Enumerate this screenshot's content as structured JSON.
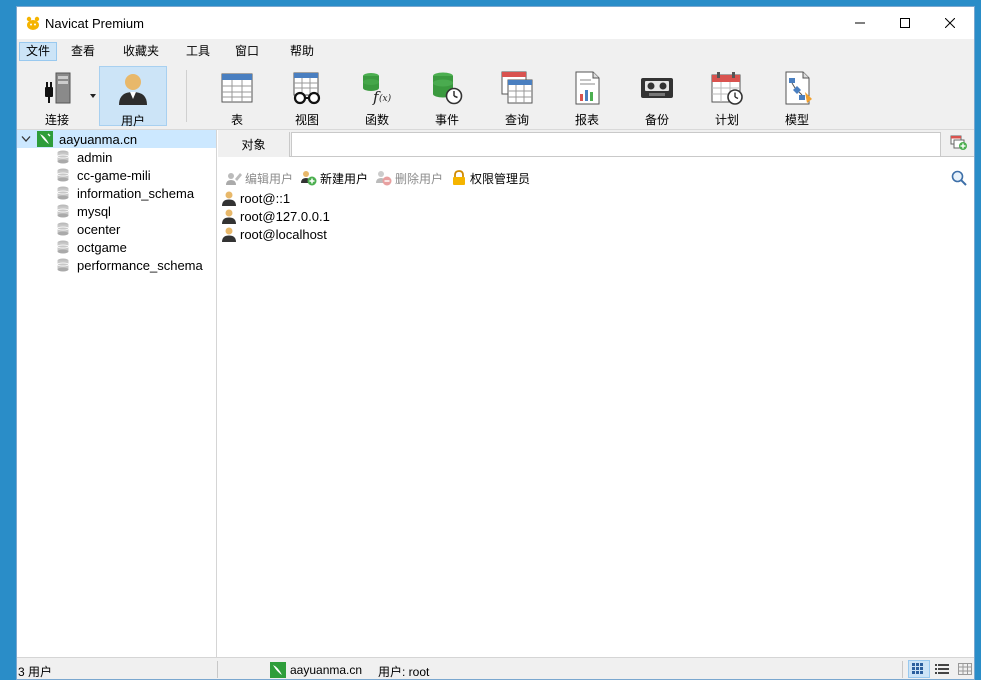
{
  "window": {
    "title": "Navicat Premium"
  },
  "menu": [
    {
      "label": "文件",
      "active": true
    },
    {
      "label": "查看"
    },
    {
      "label": "收藏夹"
    },
    {
      "label": "工具"
    },
    {
      "label": "窗口"
    },
    {
      "label": "帮助"
    }
  ],
  "toolbar": [
    {
      "label": "连接",
      "icon": "connection-icon"
    },
    {
      "label": "用户",
      "icon": "user-icon",
      "active": true
    },
    {
      "label": "表",
      "icon": "table-icon"
    },
    {
      "label": "视图",
      "icon": "view-icon"
    },
    {
      "label": "函数",
      "icon": "function-icon"
    },
    {
      "label": "事件",
      "icon": "event-icon"
    },
    {
      "label": "查询",
      "icon": "query-icon"
    },
    {
      "label": "报表",
      "icon": "report-icon"
    },
    {
      "label": "备份",
      "icon": "backup-icon"
    },
    {
      "label": "计划",
      "icon": "schedule-icon"
    },
    {
      "label": "模型",
      "icon": "model-icon"
    }
  ],
  "sidebar": {
    "connection": "aayuanma.cn",
    "databases": [
      "admin",
      "cc-game-mili",
      "information_schema",
      "mysql",
      "ocenter",
      "octgame",
      "performance_schema"
    ]
  },
  "main": {
    "tab": "对象",
    "actions": [
      {
        "label": "编辑用户",
        "disabled": true
      },
      {
        "label": "新建用户",
        "disabled": false
      },
      {
        "label": "删除用户",
        "disabled": true
      },
      {
        "label": "权限管理员",
        "disabled": false
      }
    ],
    "users": [
      "root@::1",
      "root@127.0.0.1",
      "root@localhost"
    ]
  },
  "status": {
    "count": "3 用户",
    "connection": "aayuanma.cn",
    "user": "用户: root"
  },
  "colors": {
    "accent": "#cce4f7",
    "desktop": "#2a8dc8",
    "connection_green": "#2e9d3a"
  }
}
